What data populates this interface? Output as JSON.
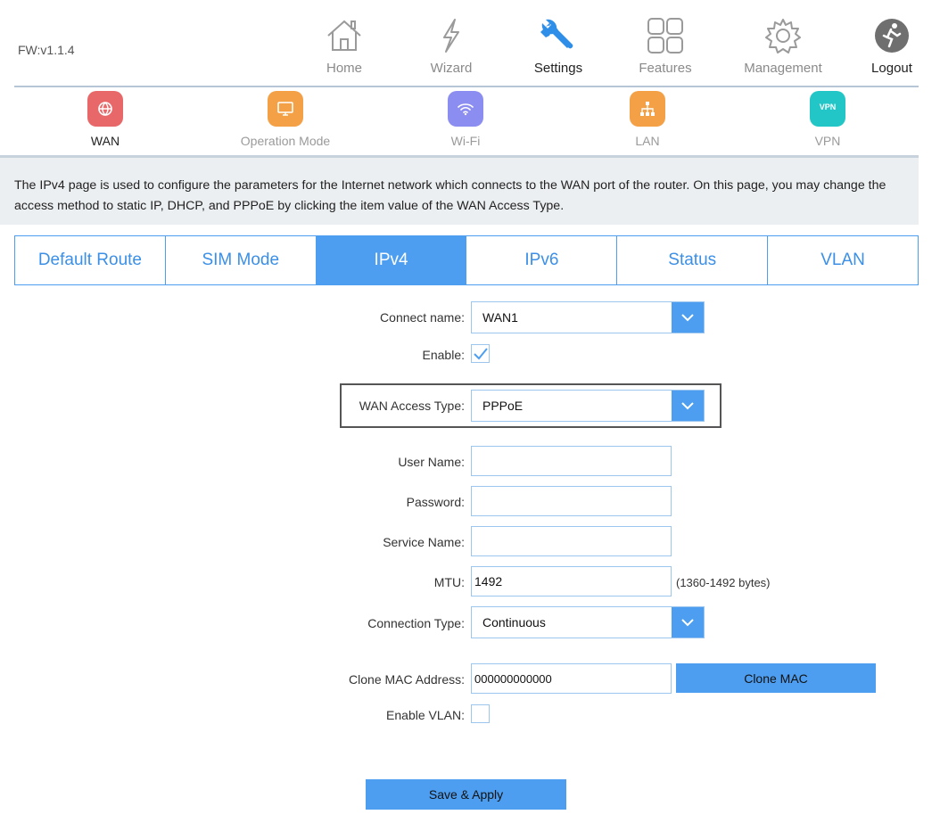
{
  "header": {
    "firmware": "FW:v1.1.4",
    "nav": [
      {
        "label": "Home",
        "icon": "home-icon"
      },
      {
        "label": "Wizard",
        "icon": "wizard-icon"
      },
      {
        "label": "Settings",
        "icon": "wrench-icon"
      },
      {
        "label": "Features",
        "icon": "features-grid-icon"
      },
      {
        "label": "Management",
        "icon": "gear-icon"
      },
      {
        "label": "Logout",
        "icon": "logout-icon"
      }
    ]
  },
  "subnav": [
    {
      "label": "WAN",
      "icon": "globe-icon",
      "color": "#e8686a"
    },
    {
      "label": "Operation Mode",
      "icon": "monitor-icon",
      "color": "#f3a046"
    },
    {
      "label": "Wi-Fi",
      "icon": "wifi-icon",
      "color": "#8c8df0"
    },
    {
      "label": "LAN",
      "icon": "network-icon",
      "color": "#f3a046"
    },
    {
      "label": "VPN",
      "icon": "vpn-icon",
      "color": "#22c6c6",
      "badge_text": "VPN"
    }
  ],
  "info": {
    "text": "The IPv4 page is used to configure the parameters for the Internet network which connects to the WAN port of the router. On this page, you may change the access method to static IP, DHCP, and PPPoE by clicking the item value of the WAN Access Type."
  },
  "tabs": [
    "Default Route",
    "SIM Mode",
    "IPv4",
    "IPv6",
    "Status",
    "VLAN"
  ],
  "form": {
    "connect_name": {
      "label": "Connect name:",
      "value": "WAN1"
    },
    "enable": {
      "label": "Enable:",
      "checked": true
    },
    "wan_access_type": {
      "label": "WAN Access Type:",
      "value": "PPPoE"
    },
    "user_name": {
      "label": "User Name:",
      "value": ""
    },
    "password": {
      "label": "Password:",
      "value": ""
    },
    "service_name": {
      "label": "Service Name:",
      "value": ""
    },
    "mtu": {
      "label": "MTU:",
      "value": "1492",
      "hint": "(1360-1492 bytes)"
    },
    "connection_type": {
      "label": "Connection Type:",
      "value": "Continuous"
    },
    "clone_mac": {
      "label": "Clone MAC Address:",
      "value": "000000000000",
      "button": "Clone MAC"
    },
    "enable_vlan": {
      "label": "Enable VLAN:",
      "checked": false
    },
    "save_button": "Save & Apply"
  },
  "colors": {
    "accent": "#4d9ef0",
    "border": "#9cc6ee"
  }
}
